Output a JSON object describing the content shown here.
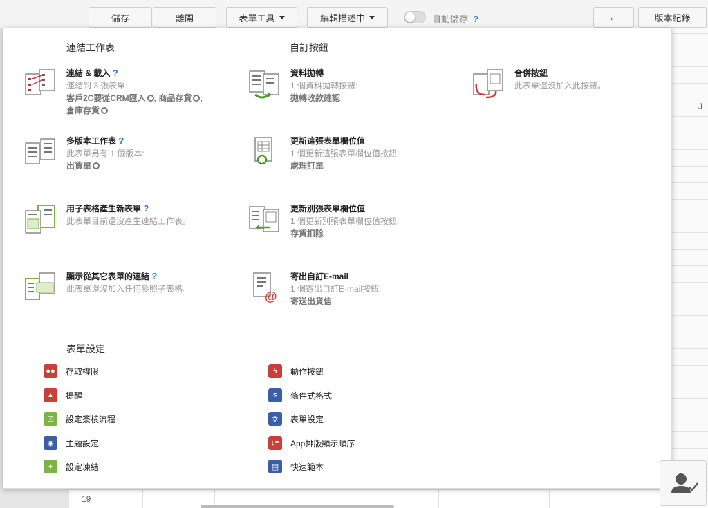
{
  "toolbar": {
    "save": "儲存",
    "leave": "離開",
    "form_tools": "表單工具",
    "edit_desc": "編輯描述中",
    "autosave": "自動儲存",
    "help": "?",
    "back_arrow": "←",
    "version": "版本紀錄"
  },
  "background": {
    "row_number": "19",
    "col_letter": "J"
  },
  "links": {
    "title": "連結工作表",
    "items": [
      {
        "name": "連結 & 載入",
        "help": "?",
        "desc": "連結到 3 張表單:",
        "sub1": "客戶2C要從CRM匯入",
        "sub2": ", 商品存貨",
        "sub3": ",",
        "sub4": "倉庫存貨",
        "icon": "link-load-icon"
      },
      {
        "name": "多版本工作表",
        "help": "?",
        "desc": "此表單另有 1 個版本:",
        "sub1": "出貨單",
        "icon": "multi-version-icon"
      },
      {
        "name": "用子表格產生新表單",
        "help": "?",
        "desc": "此表單目前還沒產生連結工作表。",
        "icon": "subtable-new-form-icon"
      },
      {
        "name": "顯示從其它表單的連結",
        "help": "?",
        "desc": "此表單還沒加入任何參照子表格。",
        "icon": "show-links-icon"
      }
    ]
  },
  "custom": {
    "title": "自訂按鈕",
    "items": [
      {
        "name": "資料拋轉",
        "desc": "1 個資料拋轉按鈕:",
        "sub": "拋轉收款確認",
        "icon": "data-transfer-icon"
      },
      {
        "name": "合併按鈕",
        "desc": "此表單還沒加入此按鈕。",
        "icon": "merge-button-icon"
      },
      {
        "name": "更新這張表單欄位值",
        "desc": "1 個更新這張表單欄位值按鈕:",
        "sub": "處理訂單",
        "icon": "update-this-form-icon"
      },
      {
        "name": "更新別張表單欄位值",
        "desc": "1 個更新別張表單欄位值按鈕:",
        "sub": "存貨扣除",
        "icon": "update-other-form-icon"
      },
      {
        "name": "寄出自訂E-mail",
        "desc": "1 個寄出自訂E-mail按鈕:",
        "sub": "寄送出貨信",
        "icon": "email-icon"
      }
    ]
  },
  "settings": {
    "title": "表單設定",
    "left": [
      {
        "label": "存取權限",
        "icon": "users-icon",
        "color": "#c9403a"
      },
      {
        "label": "提醒",
        "icon": "bell-icon",
        "color": "#c9403a"
      },
      {
        "label": "設定簽核流程",
        "icon": "check-square-icon",
        "color": "#7cb342"
      },
      {
        "label": "主題設定",
        "icon": "palette-icon",
        "color": "#3b5ea8"
      },
      {
        "label": "設定凍結",
        "icon": "pin-icon",
        "color": "#7cb342"
      }
    ],
    "right": [
      {
        "label": "動作按鈕",
        "icon": "bolt-icon",
        "color": "#c9403a"
      },
      {
        "label": "條件式格式",
        "icon": "conditional-format-icon",
        "color": "#3b5ea8"
      },
      {
        "label": "表單設定",
        "icon": "gear-icon",
        "color": "#3b5ea8"
      },
      {
        "label": "App排版顯示順序",
        "icon": "sort-order-icon",
        "color": "#c9403a"
      },
      {
        "label": "快速範本",
        "icon": "template-icon",
        "color": "#3b5ea8"
      }
    ]
  }
}
